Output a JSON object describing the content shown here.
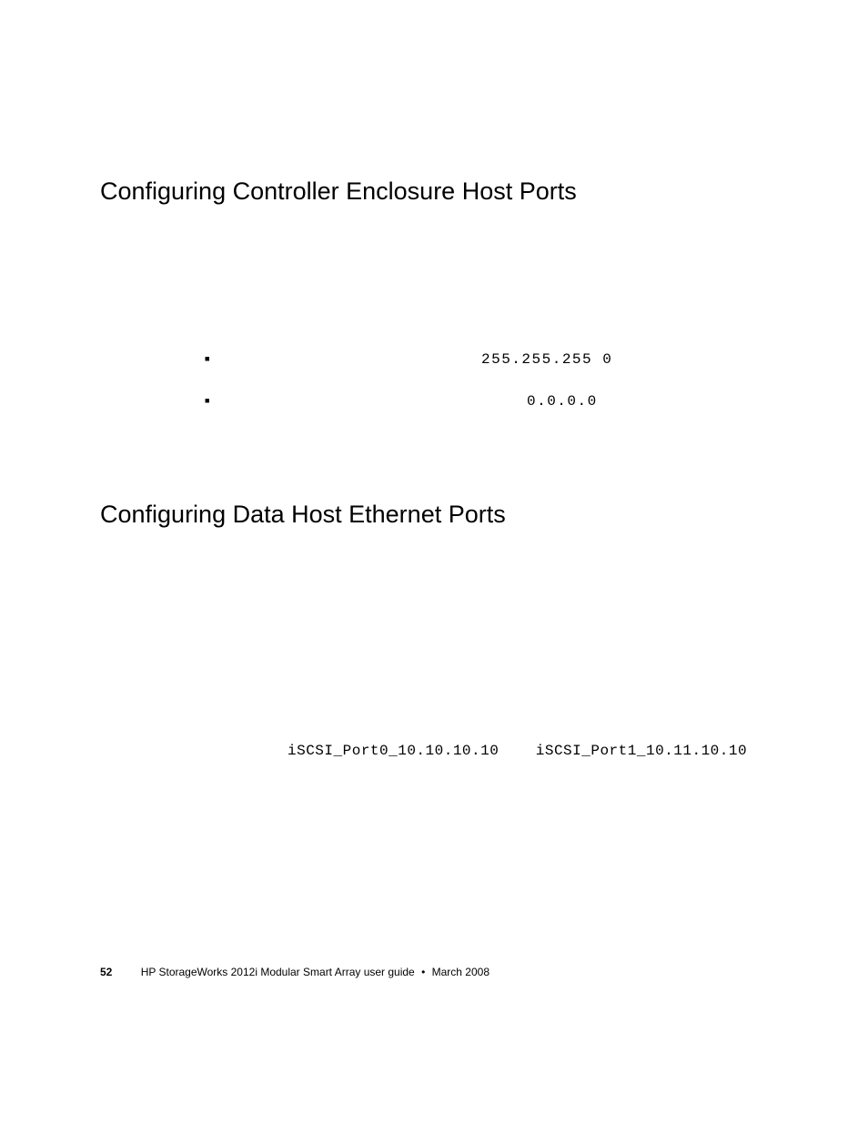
{
  "heading1": "Configuring Controller Enclosure Host Ports",
  "bullets": {
    "netmask_value": "255.255.255 0",
    "gateway_value": "0.0.0.0"
  },
  "heading2": "Configuring Data Host Ethernet Ports",
  "iscsi_line": "iSCSI_Port0_10.10.10.10    iSCSI_Port1_10.11.10.10",
  "footer": {
    "page_number": "52",
    "doc_title": "HP StorageWorks 2012i Modular Smart Array user guide",
    "separator": "•",
    "date": "March 2008"
  }
}
